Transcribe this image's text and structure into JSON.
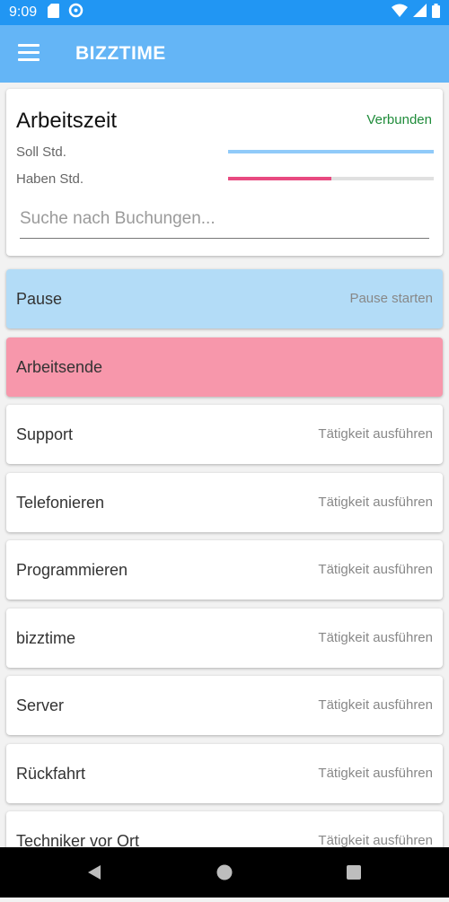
{
  "status_bar": {
    "time": "9:09",
    "icons_left": [
      "sd-card-icon",
      "data-saver-icon"
    ],
    "icons_right": [
      "wifi-icon",
      "signal-icon",
      "battery-icon"
    ]
  },
  "app_bar": {
    "title": "BIZZTIME",
    "menu_icon": "menu-icon"
  },
  "summary": {
    "title": "Arbeitszeit",
    "connection_status": "Verbunden",
    "soll_label": "Soll Std.",
    "soll_progress": 1.0,
    "haben_label": "Haben Std.",
    "haben_progress": 0.5,
    "search_placeholder": "Suche nach Buchungen..."
  },
  "actions": [
    {
      "label": "Pause",
      "hint": "Pause starten",
      "color": "#b3dcf7"
    },
    {
      "label": "Arbeitsende",
      "hint": "",
      "color": "#f797ab"
    },
    {
      "label": "Support",
      "hint": "Tätigkeit ausführen",
      "color": "#ffffff"
    },
    {
      "label": "Telefonieren",
      "hint": "Tätigkeit ausführen",
      "color": "#ffffff"
    },
    {
      "label": "Programmieren",
      "hint": "Tätigkeit ausführen",
      "color": "#ffffff"
    },
    {
      "label": "bizztime",
      "hint": "Tätigkeit ausführen",
      "color": "#ffffff"
    },
    {
      "label": "Server",
      "hint": "Tätigkeit ausführen",
      "color": "#ffffff"
    },
    {
      "label": "Rückfahrt",
      "hint": "Tätigkeit ausführen",
      "color": "#ffffff"
    },
    {
      "label": "Techniker vor Ort",
      "hint": "Tätigkeit ausführen",
      "color": "#ffffff"
    }
  ],
  "colors": {
    "status_bar": "#2196f3",
    "app_bar": "#64b5f6",
    "soll_bar": "#90caf9",
    "haben_bar": "#e84a80",
    "connected": "#1f8c3a"
  },
  "nav_bar": {
    "icons": [
      "back-icon",
      "home-icon",
      "recents-icon"
    ]
  }
}
